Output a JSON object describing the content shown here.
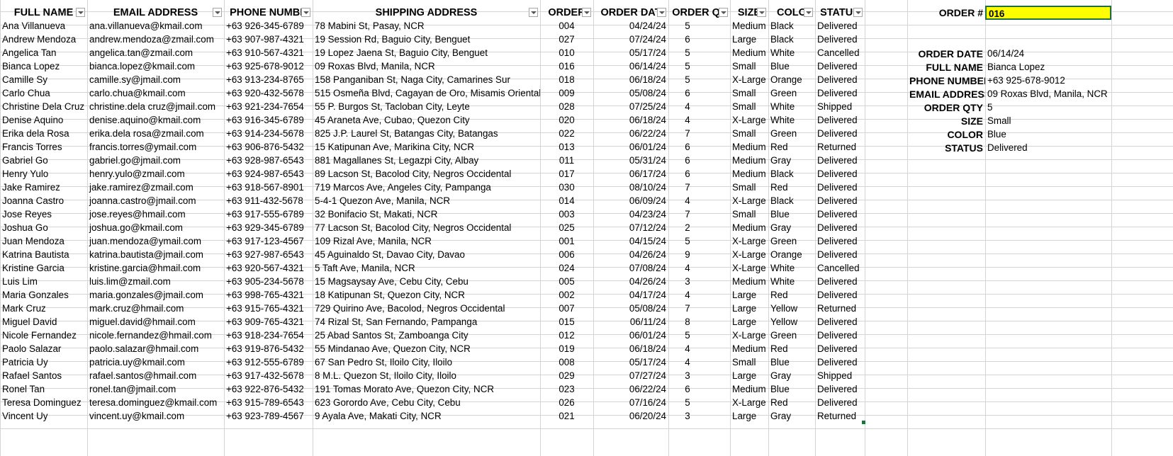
{
  "headers": [
    "FULL NAME",
    "EMAIL ADDRESS",
    "PHONE NUMBE",
    "SHIPPING ADDRESS",
    "ORDER",
    "ORDER DAT",
    "ORDER QT",
    "SIZE",
    "COLO",
    "STATUS"
  ],
  "rows": [
    [
      "Ana Villanueva",
      "ana.villanueva@kmail.com",
      "+63 926-345-6789",
      "78 Mabini St, Pasay, NCR",
      "004",
      "04/24/24",
      "5",
      "Medium",
      "Black",
      "Delivered"
    ],
    [
      "Andrew Mendoza",
      "andrew.mendoza@zmail.com",
      "+63 907-987-4321",
      "19 Session Rd, Baguio City, Benguet",
      "027",
      "07/24/24",
      "6",
      "Large",
      "Black",
      "Delivered"
    ],
    [
      "Angelica Tan",
      "angelica.tan@zmail.com",
      "+63 910-567-4321",
      "19 Lopez Jaena St, Baguio City, Benguet",
      "010",
      "05/17/24",
      "5",
      "Medium",
      "White",
      "Cancelled"
    ],
    [
      "Bianca Lopez",
      "bianca.lopez@kmail.com",
      "+63 925-678-9012",
      "09 Roxas Blvd, Manila, NCR",
      "016",
      "06/14/24",
      "5",
      "Small",
      "Blue",
      "Delivered"
    ],
    [
      "Camille Sy",
      "camille.sy@jmail.com",
      "+63 913-234-8765",
      "158 Panganiban St, Naga City, Camarines Sur",
      "018",
      "06/18/24",
      "5",
      "X-Large",
      "Orange",
      "Delivered"
    ],
    [
      "Carlo Chua",
      "carlo.chua@kmail.com",
      "+63 920-432-5678",
      "515 Osmeña Blvd, Cagayan de Oro, Misamis Oriental",
      "009",
      "05/08/24",
      "6",
      "Small",
      "Green",
      "Delivered"
    ],
    [
      "Christine Dela Cruz",
      "christine.dela cruz@jmail.com",
      "+63 921-234-7654",
      "55 P. Burgos St, Tacloban City, Leyte",
      "028",
      "07/25/24",
      "4",
      "Small",
      "White",
      "Shipped"
    ],
    [
      "Denise Aquino",
      "denise.aquino@kmail.com",
      "+63 916-345-6789",
      "45 Araneta Ave, Cubao, Quezon City",
      "020",
      "06/18/24",
      "4",
      "X-Large",
      "White",
      "Delivered"
    ],
    [
      "Erika dela Rosa",
      "erika.dela rosa@zmail.com",
      "+63 914-234-5678",
      "825 J.P. Laurel St, Batangas City, Batangas",
      "022",
      "06/22/24",
      "7",
      "Small",
      "Green",
      "Delivered"
    ],
    [
      "Francis Torres",
      "francis.torres@ymail.com",
      "+63 906-876-5432",
      "15 Katipunan Ave, Marikina City, NCR",
      "013",
      "06/01/24",
      "6",
      "Medium",
      "Red",
      "Returned"
    ],
    [
      "Gabriel Go",
      "gabriel.go@jmail.com",
      "+63 928-987-6543",
      "881 Magallanes St, Legazpi City, Albay",
      "011",
      "05/31/24",
      "6",
      "Medium",
      "Gray",
      "Delivered"
    ],
    [
      "Henry Yulo",
      "henry.yulo@zmail.com",
      "+63 924-987-6543",
      "89 Lacson St, Bacolod City, Negros Occidental",
      "017",
      "06/17/24",
      "6",
      "Medium",
      "Black",
      "Delivered"
    ],
    [
      "Jake Ramirez",
      "jake.ramirez@zmail.com",
      "+63 918-567-8901",
      "719 Marcos Ave, Angeles City, Pampanga",
      "030",
      "08/10/24",
      "7",
      "Small",
      "Red",
      "Delivered"
    ],
    [
      "Joanna Castro",
      "joanna.castro@jmail.com",
      "+63 911-432-5678",
      "5-4-1 Quezon Ave, Manila, NCR",
      "014",
      "06/09/24",
      "4",
      "X-Large",
      "Black",
      "Delivered"
    ],
    [
      "Jose Reyes",
      "jose.reyes@hmail.com",
      "+63 917-555-6789",
      "32 Bonifacio St, Makati, NCR",
      "003",
      "04/23/24",
      "7",
      "Small",
      "Blue",
      "Delivered"
    ],
    [
      "Joshua Go",
      "joshua.go@kmail.com",
      "+63 929-345-6789",
      "77 Lacson St, Bacolod City, Negros Occidental",
      "025",
      "07/12/24",
      "2",
      "Medium",
      "Gray",
      "Delivered"
    ],
    [
      "Juan Mendoza",
      "juan.mendoza@ymail.com",
      "+63 917-123-4567",
      "109 Rizal Ave, Manila, NCR",
      "001",
      "04/15/24",
      "5",
      "X-Large",
      "Green",
      "Delivered"
    ],
    [
      "Katrina Bautista",
      "katrina.bautista@jmail.com",
      "+63 927-987-6543",
      "45 Aguinaldo St, Davao City, Davao",
      "006",
      "04/26/24",
      "9",
      "X-Large",
      "Orange",
      "Delivered"
    ],
    [
      "Kristine Garcia",
      "kristine.garcia@hmail.com",
      "+63 920-567-4321",
      "5 Taft Ave, Manila, NCR",
      "024",
      "07/08/24",
      "4",
      "X-Large",
      "White",
      "Cancelled"
    ],
    [
      "Luis Lim",
      "luis.lim@zmail.com",
      "+63 905-234-5678",
      "15 Magsaysay Ave, Cebu City, Cebu",
      "005",
      "04/26/24",
      "3",
      "Medium",
      "White",
      "Delivered"
    ],
    [
      "Maria Gonzales",
      "maria.gonzales@jmail.com",
      "+63 998-765-4321",
      "18 Katipunan St, Quezon City, NCR",
      "002",
      "04/17/24",
      "4",
      "Large",
      "Red",
      "Delivered"
    ],
    [
      "Mark Cruz",
      "mark.cruz@hmail.com",
      "+63 915-765-4321",
      "729 Quirino Ave, Bacolod, Negros Occidental",
      "007",
      "05/08/24",
      "7",
      "Large",
      "Yellow",
      "Returned"
    ],
    [
      "Miguel David",
      "miguel.david@hmail.com",
      "+63 909-765-4321",
      "74 Rizal St, San Fernando, Pampanga",
      "015",
      "06/11/24",
      "8",
      "Large",
      "Yellow",
      "Delivered"
    ],
    [
      "Nicole Fernandez",
      "nicole.fernandez@hmail.com",
      "+63 918-234-7654",
      "25 Abad Santos St, Zamboanga City",
      "012",
      "06/01/24",
      "5",
      "X-Large",
      "Green",
      "Delivered"
    ],
    [
      "Paolo Salazar",
      "paolo.salazar@hmail.com",
      "+63 919-876-5432",
      "55 Mindanao Ave, Quezon City, NCR",
      "019",
      "06/18/24",
      "4",
      "Medium",
      "Red",
      "Delivered"
    ],
    [
      "Patricia Uy",
      "patricia.uy@kmail.com",
      "+63 912-555-6789",
      "67 San Pedro St, Iloilo City, Iloilo",
      "008",
      "05/17/24",
      "4",
      "Small",
      "Blue",
      "Delivered"
    ],
    [
      "Rafael Santos",
      "rafael.santos@hmail.com",
      "+63 917-432-5678",
      "8 M.L. Quezon St, Iloilo City, Iloilo",
      "029",
      "07/27/24",
      "3",
      "Large",
      "Gray",
      "Shipped"
    ],
    [
      "Ronel Tan",
      "ronel.tan@jmail.com",
      "+63 922-876-5432",
      "191 Tomas Morato Ave, Quezon City, NCR",
      "023",
      "06/22/24",
      "6",
      "Medium",
      "Blue",
      "Delivered"
    ],
    [
      "Teresa Dominguez",
      "teresa.dominguez@kmail.com",
      "+63 915-789-6543",
      "623 Gorordo Ave, Cebu City, Cebu",
      "026",
      "07/16/24",
      "5",
      "X-Large",
      "Red",
      "Delivered"
    ],
    [
      "Vincent Uy",
      "vincent.uy@kmail.com",
      "+63 923-789-4567",
      "9 Ayala Ave, Makati City, NCR",
      "021",
      "06/20/24",
      "3",
      "Large",
      "Gray",
      "Returned"
    ]
  ],
  "lookup": {
    "order_label": "ORDER #",
    "order_value": "016",
    "fields": [
      {
        "label": "ORDER DATE",
        "value": "06/14/24"
      },
      {
        "label": "FULL NAME",
        "value": "Bianca Lopez"
      },
      {
        "label": "PHONE NUMBER",
        "value": "+63 925-678-9012"
      },
      {
        "label": "EMAIL ADDRESS",
        "value": "09 Roxas Blvd, Manila, NCR"
      },
      {
        "label": "ORDER QTY",
        "value": "5"
      },
      {
        "label": "SIZE",
        "value": "Small"
      },
      {
        "label": "COLOR",
        "value": "Blue"
      },
      {
        "label": "STATUS",
        "value": "Delivered"
      }
    ]
  },
  "colors": {
    "highlight": "#ffff00",
    "gridline": "#d4d4d4",
    "selection": "#1f6f3f"
  }
}
